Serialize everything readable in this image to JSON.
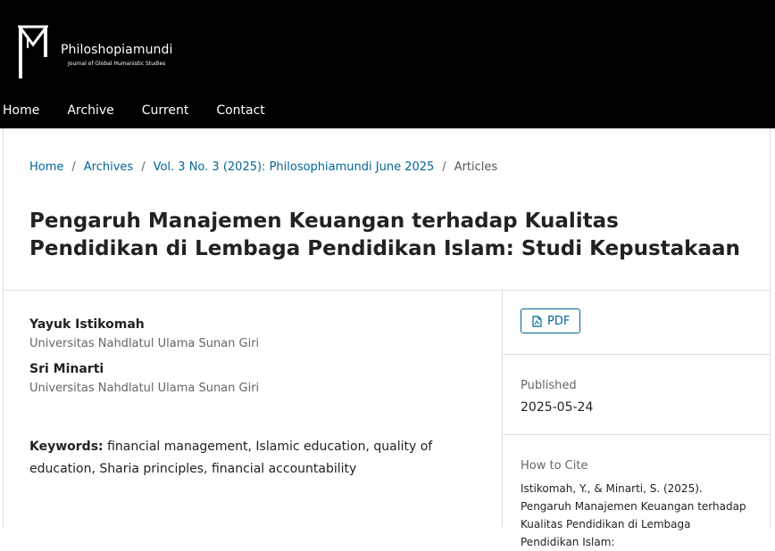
{
  "header": {
    "site_name": "Philoshopiamundi",
    "site_tagline": "Journal of Global Humanistic Studies",
    "nav": [
      {
        "label": "Home"
      },
      {
        "label": "Archive"
      },
      {
        "label": "Current"
      },
      {
        "label": "Contact"
      }
    ]
  },
  "breadcrumb": {
    "items": [
      "Home",
      "Archives",
      "Vol. 3 No. 3 (2025): Philosophiamundi June 2025",
      "Articles"
    ],
    "separator": "/"
  },
  "article": {
    "title": "Pengaruh Manajemen Keuangan terhadap Kualitas Pendidikan di Lembaga Pendidikan Islam: Studi Kepustakaan",
    "authors": [
      {
        "name": "Yayuk Istikomah",
        "affiliation": "Universitas Nahdlatul Ulama Sunan Giri"
      },
      {
        "name": "Sri Minarti",
        "affiliation": "Universitas Nahdlatul Ulama Sunan Giri"
      }
    ],
    "keywords_label": "Keywords:",
    "keywords": "financial management, Islamic education, quality of education, Sharia principles, financial accountability"
  },
  "sidebar": {
    "pdf_label": "PDF",
    "published_label": "Published",
    "published_date": "2025-05-24",
    "cite_label": "How to Cite",
    "cite_text": "Istikomah, Y., & Minarti, S. (2025). Pengaruh Manajemen Keuangan terhadap Kualitas Pendidikan di Lembaga Pendidikan Islam:"
  },
  "colors": {
    "header_bg": "#000000",
    "link": "#006798",
    "border": "#dddddd"
  }
}
